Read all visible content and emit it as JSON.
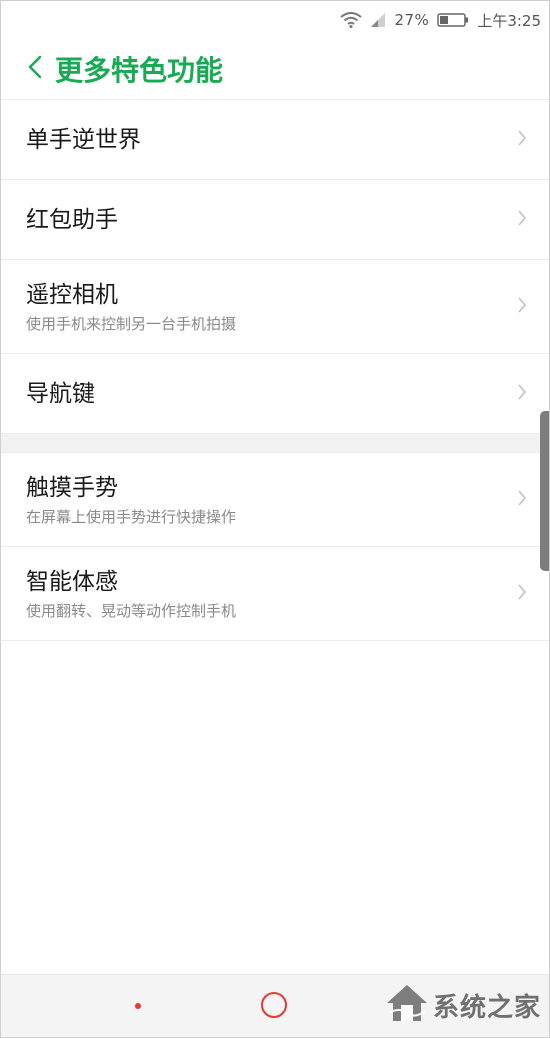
{
  "status_bar": {
    "battery_percent": "27%",
    "time": "上午3:25",
    "wifi_icon": "wifi-icon",
    "signal_icon": "signal-icon",
    "battery_icon": "battery-icon"
  },
  "header": {
    "back_icon": "chevron-left-icon",
    "title": "更多特色功能",
    "accent_color": "#1aaa55"
  },
  "group1": [
    {
      "title": "单手逆世界",
      "subtitle": ""
    },
    {
      "title": "红包助手",
      "subtitle": ""
    },
    {
      "title": "遥控相机",
      "subtitle": "使用手机来控制另一台手机拍摄"
    },
    {
      "title": "导航键",
      "subtitle": ""
    }
  ],
  "group2": [
    {
      "title": "触摸手势",
      "subtitle": "在屏幕上使用手势进行快捷操作"
    },
    {
      "title": "智能体感",
      "subtitle": "使用翻转、晃动等动作控制手机"
    }
  ],
  "nav": {
    "home_icon": "home-circle-icon",
    "menu_icon": "dot-icon",
    "accent_color": "#e53935"
  },
  "watermark": {
    "text": "系统之家"
  }
}
